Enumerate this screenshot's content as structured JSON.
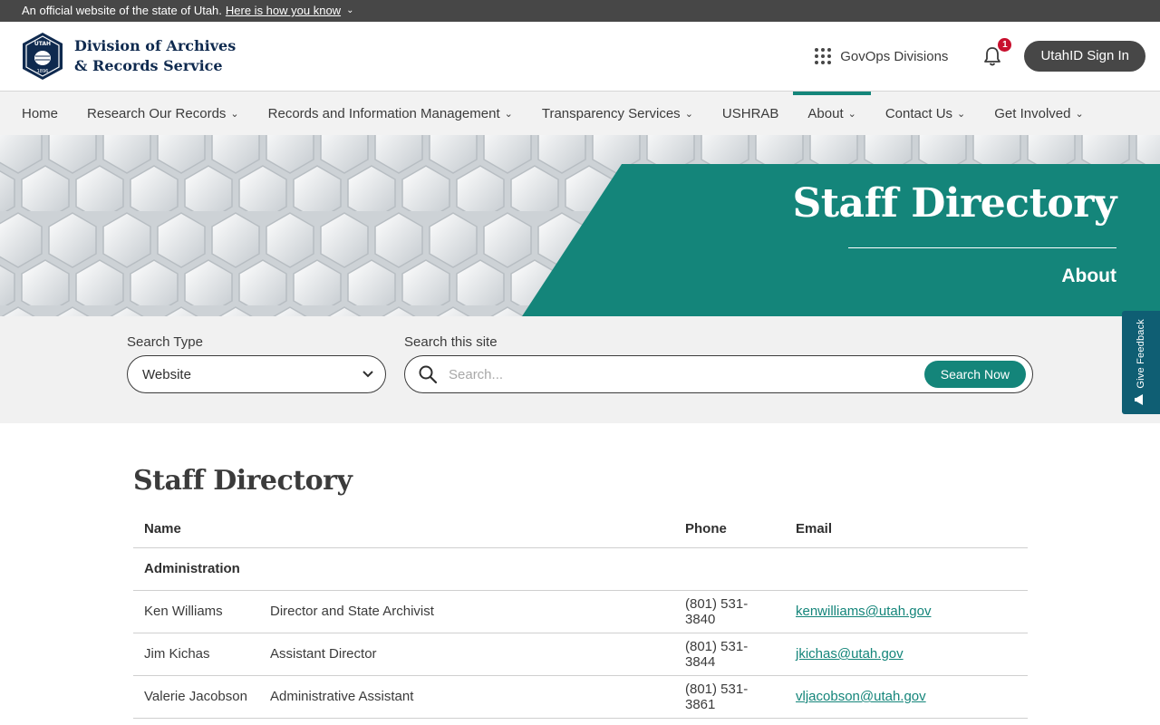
{
  "official_banner": {
    "text": "An official website of the state of Utah.",
    "link": "Here is how you know"
  },
  "header": {
    "logo_seal_text": "UTAH",
    "logo_seal_year": "1896",
    "logo_line1": "Division of Archives",
    "logo_line2": "& Records Service",
    "govops_label": "GovOps Divisions",
    "notification_count": "1",
    "signin_label": "UtahID Sign In"
  },
  "nav": {
    "items": [
      {
        "label": "Home",
        "dropdown": false
      },
      {
        "label": "Research Our Records",
        "dropdown": true
      },
      {
        "label": "Records and Information Management",
        "dropdown": true
      },
      {
        "label": "Transparency Services",
        "dropdown": true
      },
      {
        "label": "USHRAB",
        "dropdown": false
      },
      {
        "label": "About",
        "dropdown": true,
        "active": true
      },
      {
        "label": "Contact Us",
        "dropdown": true
      },
      {
        "label": "Get Involved",
        "dropdown": true
      }
    ]
  },
  "hero": {
    "title": "Staff Directory",
    "subtitle": "About"
  },
  "search": {
    "type_label": "Search Type",
    "type_value": "Website",
    "site_label": "Search this site",
    "placeholder": "Search...",
    "button_label": "Search Now"
  },
  "feedback": {
    "label": "Give Feedback"
  },
  "main": {
    "title": "Staff Directory",
    "table": {
      "headers": {
        "name": "Name",
        "title": "",
        "phone": "Phone",
        "email": "Email"
      },
      "section": "Administration",
      "rows": [
        {
          "name": "Ken Williams",
          "title": "Director and State Archivist",
          "phone": "(801) 531-3840",
          "email": "kenwilliams@utah.gov"
        },
        {
          "name": "Jim Kichas",
          "title": "Assistant Director",
          "phone": "(801) 531-3844",
          "email": "jkichas@utah.gov"
        },
        {
          "name": "Valerie Jacobson",
          "title": "Administrative Assistant",
          "phone": "(801) 531-3861",
          "email": "vljacobson@utah.gov"
        }
      ]
    }
  },
  "colors": {
    "accent": "#14857a",
    "banner": "#474747",
    "logo_navy": "#0f2a4f",
    "feedback_tab": "#0f5e73"
  }
}
